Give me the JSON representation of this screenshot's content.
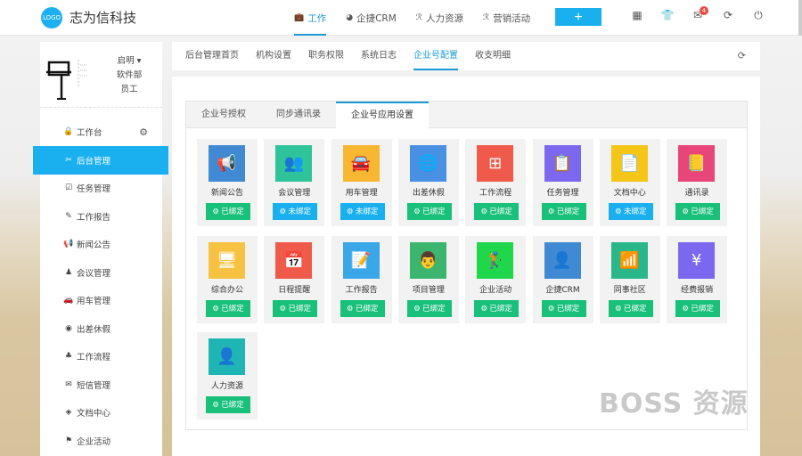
{
  "header": {
    "logo_text": "LOGO",
    "brand": "志为信科技",
    "nav": [
      {
        "label": "工作",
        "icon": "briefcase-icon",
        "glyph": "💼",
        "active": true
      },
      {
        "label": "企捷CRM",
        "icon": "pie-chart-icon",
        "glyph": "◕",
        "active": false
      },
      {
        "label": "人力资源",
        "icon": "users-icon",
        "glyph": "ℛ",
        "active": false
      },
      {
        "label": "营销活动",
        "icon": "users-icon",
        "glyph": "ℛ",
        "active": false
      }
    ],
    "add_button": "+",
    "icons": [
      {
        "name": "qrcode-icon",
        "glyph": "▦"
      },
      {
        "name": "shirt-icon",
        "glyph": "👕"
      },
      {
        "name": "mail-icon",
        "glyph": "✉",
        "badge": "4"
      },
      {
        "name": "refresh-icon",
        "glyph": "⟳"
      },
      {
        "name": "power-icon",
        "glyph": "⏻"
      }
    ]
  },
  "user": {
    "name": "启明 ▾",
    "department": "软件部",
    "role": "员工"
  },
  "sidebar": {
    "items": [
      {
        "label": "工作台",
        "icon": "lock-icon",
        "glyph": "🔒",
        "active": false,
        "settings": true
      },
      {
        "label": "后台管理",
        "icon": "tools-icon",
        "glyph": "✂",
        "active": true
      },
      {
        "label": "任务管理",
        "icon": "checkbox-icon",
        "glyph": "☑",
        "active": false
      },
      {
        "label": "工作报告",
        "icon": "edit-icon",
        "glyph": "✎",
        "active": false
      },
      {
        "label": "新闻公告",
        "icon": "bullhorn-icon",
        "glyph": "📢",
        "active": false
      },
      {
        "label": "会议管理",
        "icon": "meeting-icon",
        "glyph": "♟",
        "active": false
      },
      {
        "label": "用车管理",
        "icon": "car-icon",
        "glyph": "🚗",
        "active": false
      },
      {
        "label": "出差休假",
        "icon": "location-icon",
        "glyph": "◉",
        "active": false
      },
      {
        "label": "工作流程",
        "icon": "sitemap-icon",
        "glyph": "♣",
        "active": false
      },
      {
        "label": "短信管理",
        "icon": "envelope-icon",
        "glyph": "✉",
        "active": false
      },
      {
        "label": "文档中心",
        "icon": "layers-icon",
        "glyph": "◈",
        "active": false
      },
      {
        "label": "企业活动",
        "icon": "flag-icon",
        "glyph": "⚑",
        "active": false
      }
    ]
  },
  "tabs": [
    {
      "label": "后台管理首页",
      "active": false
    },
    {
      "label": "机构设置",
      "active": false
    },
    {
      "label": "职务权限",
      "active": false
    },
    {
      "label": "系统日志",
      "active": false
    },
    {
      "label": "企业号配置",
      "active": true
    },
    {
      "label": "收支明细",
      "active": false
    }
  ],
  "inner_tabs": [
    {
      "label": "企业号授权",
      "active": false
    },
    {
      "label": "同步通讯录",
      "active": false
    },
    {
      "label": "企业号应用设置",
      "active": true
    }
  ],
  "bound_label": "已绑定",
  "unbound_label": "未绑定",
  "apps": [
    {
      "label": "新闻公告",
      "icon": "megaphone-icon",
      "glyph": "📢",
      "color": "#3f8ad3",
      "bound": true
    },
    {
      "label": "会议管理",
      "icon": "meeting-icon",
      "glyph": "👥",
      "color": "#2fc39a",
      "bound": false
    },
    {
      "label": "用车管理",
      "icon": "car-icon",
      "glyph": "🚘",
      "color": "#f7b731",
      "bound": false
    },
    {
      "label": "出差休假",
      "icon": "globe-plane-icon",
      "glyph": "🌐",
      "color": "#4a90e2",
      "bound": true
    },
    {
      "label": "工作流程",
      "icon": "sitemap-icon",
      "glyph": "⊞",
      "color": "#f05a4a",
      "bound": true
    },
    {
      "label": "任务管理",
      "icon": "clipboard-icon",
      "glyph": "📋",
      "color": "#7b68ee",
      "bound": true
    },
    {
      "label": "文档中心",
      "icon": "document-chart-icon",
      "glyph": "📄",
      "color": "#f5c518",
      "bound": false
    },
    {
      "label": "通讯录",
      "icon": "contacts-book-icon",
      "glyph": "📒",
      "color": "#e8457a",
      "bound": true
    },
    {
      "label": "综合办公",
      "icon": "monitor-icon",
      "glyph": "🖥",
      "color": "#f7c242",
      "bound": true
    },
    {
      "label": "日程提醒",
      "icon": "calendar-icon",
      "glyph": "📅",
      "color": "#f05a4a",
      "bound": true
    },
    {
      "label": "工作报告",
      "icon": "report-icon",
      "glyph": "📝",
      "color": "#3aa7e8",
      "bound": true
    },
    {
      "label": "项目管理",
      "icon": "presenter-icon",
      "glyph": "👨",
      "color": "#3cb66e",
      "bound": true
    },
    {
      "label": "企业活动",
      "icon": "golf-icon",
      "glyph": "🏌",
      "color": "#20d64a",
      "bound": true
    },
    {
      "label": "企捷CRM",
      "icon": "user-tie-icon",
      "glyph": "👤",
      "color": "#3f8ad3",
      "bound": true
    },
    {
      "label": "同事社区",
      "icon": "community-icon",
      "glyph": "📶",
      "color": "#2ab88a",
      "bound": true
    },
    {
      "label": "经费报销",
      "icon": "expense-icon",
      "glyph": "¥",
      "color": "#7b68ee",
      "bound": true
    },
    {
      "label": "人力资源",
      "icon": "add-user-icon",
      "glyph": "👤",
      "color": "#1fb5b5",
      "bound": true
    }
  ],
  "watermark": "BOSS 资源"
}
